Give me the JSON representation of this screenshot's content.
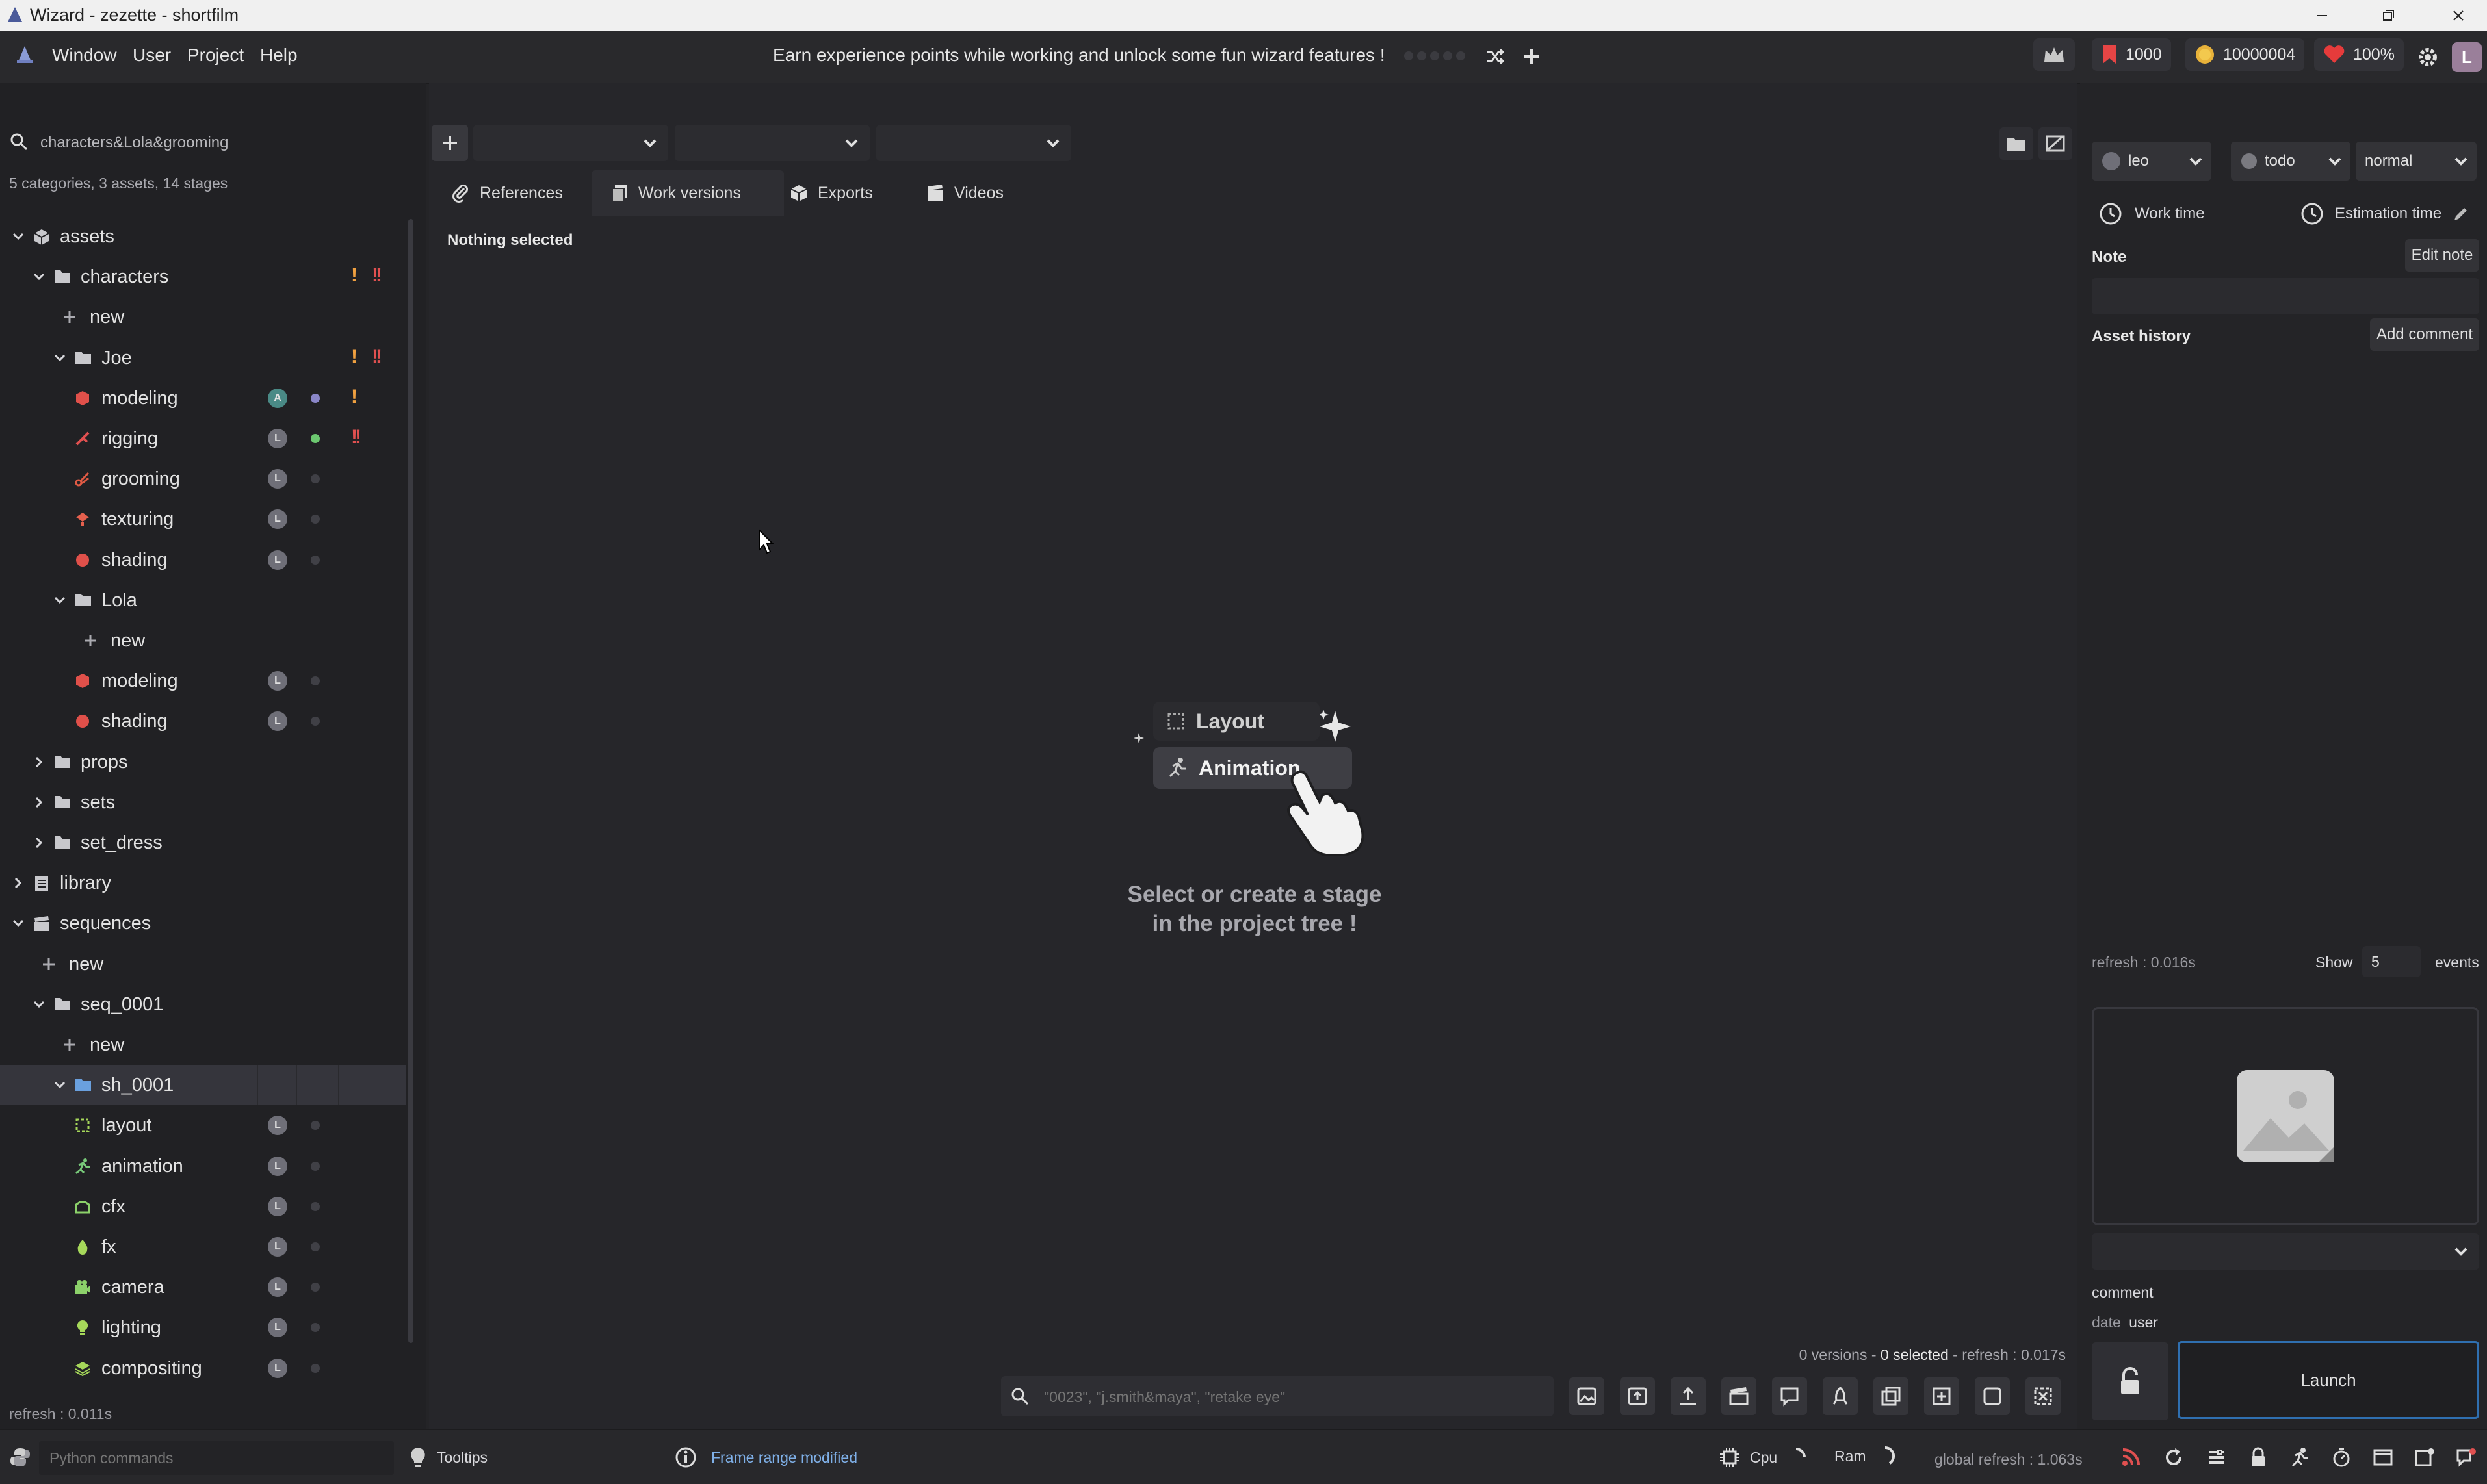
{
  "window": {
    "title": "Wizard - zezette - shortfilm"
  },
  "menu": {
    "items": [
      "Window",
      "User",
      "Project",
      "Help"
    ],
    "banner": "Earn experience points while working and unlock some fun wizard features !",
    "stats": {
      "bookmarks": "1000",
      "coins": "10000004",
      "health": "100%"
    },
    "user_initial": "L"
  },
  "tree": {
    "search_value": "characters&Lola&grooming",
    "summary": "5 categories, 3 assets, 14 stages",
    "refresh": "refresh : 0.011s",
    "rows": [
      {
        "label": "assets"
      },
      {
        "label": "characters"
      },
      {
        "label": "new"
      },
      {
        "label": "Joe"
      },
      {
        "label": "modeling",
        "avatar": "A"
      },
      {
        "label": "rigging",
        "avatar": "L"
      },
      {
        "label": "grooming",
        "avatar": "L"
      },
      {
        "label": "texturing",
        "avatar": "L"
      },
      {
        "label": "shading",
        "avatar": "L"
      },
      {
        "label": "Lola"
      },
      {
        "label": "new"
      },
      {
        "label": "modeling",
        "avatar": "L"
      },
      {
        "label": "shading",
        "avatar": "L"
      },
      {
        "label": "props"
      },
      {
        "label": "sets"
      },
      {
        "label": "set_dress"
      },
      {
        "label": "library"
      },
      {
        "label": "sequences"
      },
      {
        "label": "new"
      },
      {
        "label": "seq_0001"
      },
      {
        "label": "new"
      },
      {
        "label": "sh_0001"
      },
      {
        "label": "layout",
        "avatar": "L"
      },
      {
        "label": "animation",
        "avatar": "L"
      },
      {
        "label": "cfx",
        "avatar": "L"
      },
      {
        "label": "fx",
        "avatar": "L"
      },
      {
        "label": "camera",
        "avatar": "L"
      },
      {
        "label": "lighting",
        "avatar": "L"
      },
      {
        "label": "compositing",
        "avatar": "L"
      }
    ]
  },
  "center": {
    "tabs": [
      "References",
      "Work versions",
      "Exports",
      "Videos"
    ],
    "nothing_selected": "Nothing selected",
    "illustration": {
      "stage1": "Layout",
      "stage2": "Animation"
    },
    "empty_line1": "Select or create a stage",
    "empty_line2": "in the project tree !",
    "footer": {
      "versions": "0 versions - ",
      "selected": "0 selected",
      "refresh": " - refresh : 0.017s"
    },
    "search_placeholder": "\"0023\", \"j.smith&maya\", \"retake eye\""
  },
  "right": {
    "user": "leo",
    "state": "todo",
    "priority": "normal",
    "work_time": "Work time",
    "estimation_time": "Estimation time",
    "note_label": "Note",
    "edit_note": "Edit note",
    "history_label": "Asset history",
    "add_comment": "Add comment",
    "refresh": "refresh : 0.016s",
    "show_label": "Show",
    "show_count": "5",
    "events_label": "events",
    "comment_label": "comment",
    "date_label": "date",
    "user_label": "user",
    "launch": "Launch"
  },
  "status": {
    "python_placeholder": "Python commands",
    "tooltips": "Tooltips",
    "message": "Frame range modified",
    "cpu": "Cpu",
    "ram": "Ram",
    "global_refresh": "global refresh : 1.063s"
  },
  "colors": {
    "background": "#242427",
    "accent": "#2f6fb0",
    "modeling": "#e0504a",
    "rigging": "#e05050",
    "grooming": "#e05a44",
    "lighting": "#a6d85a",
    "animation": "#78c97a"
  }
}
